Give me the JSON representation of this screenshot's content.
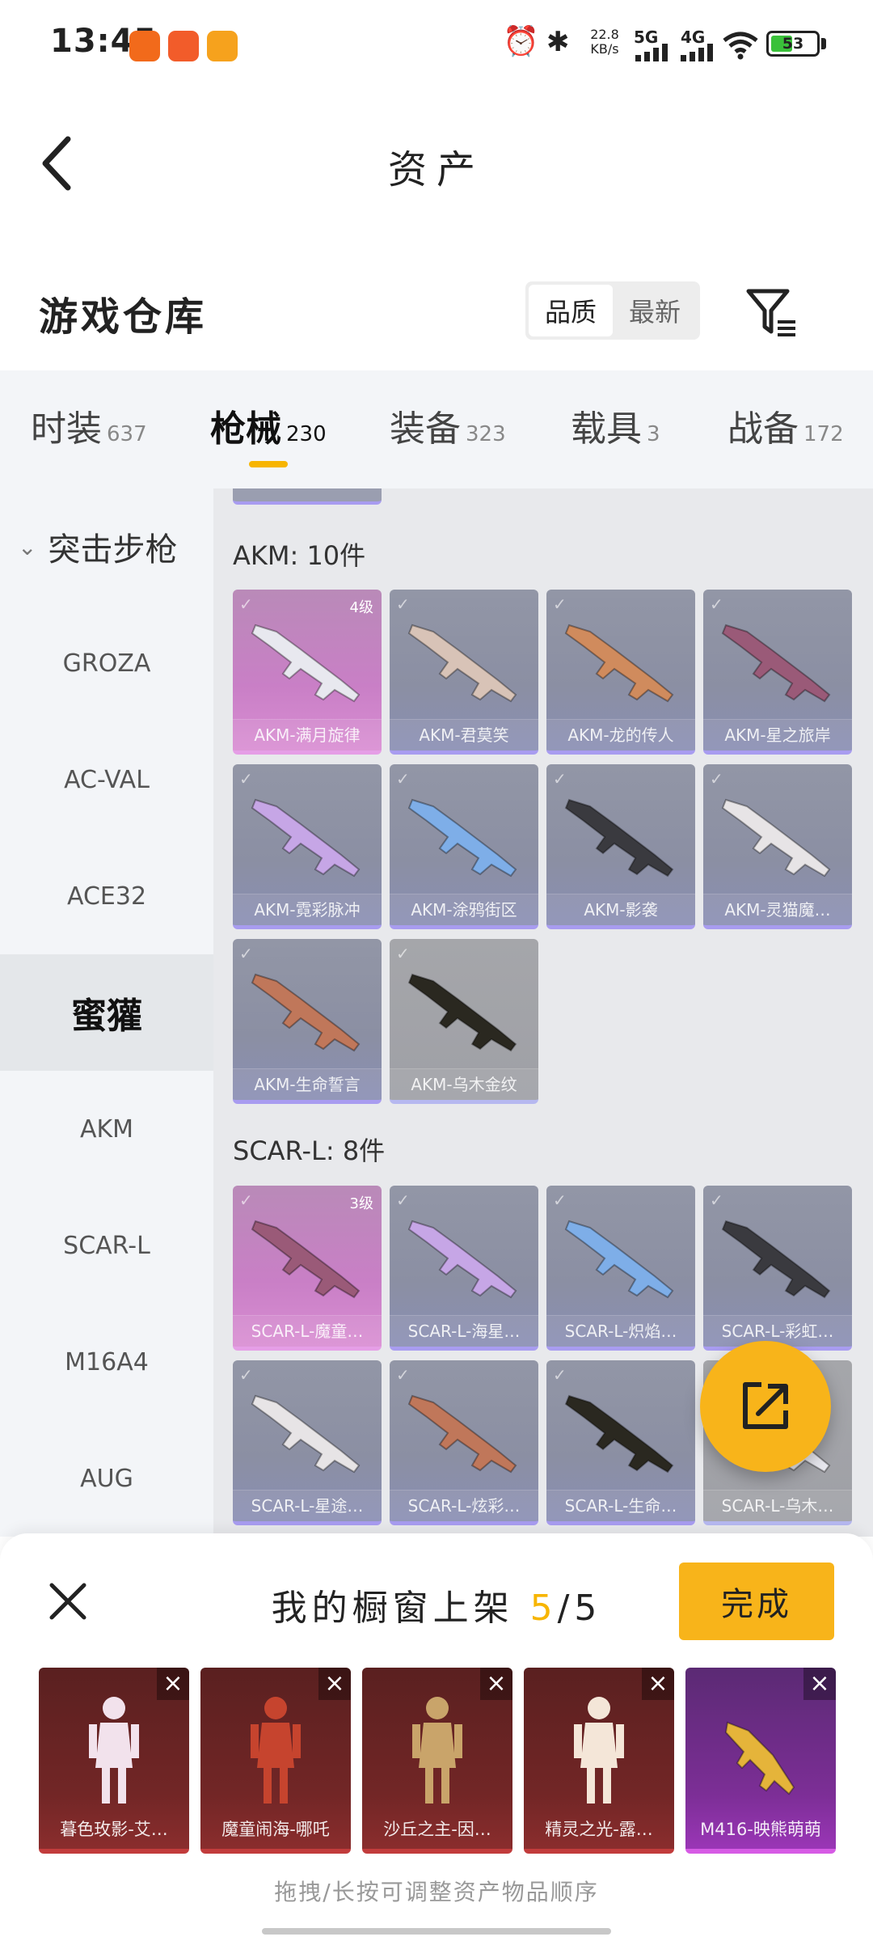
{
  "status": {
    "time": "13:45",
    "net_speed": "22.8",
    "net_unit": "KB/s",
    "net1": "5G",
    "net2": "4G",
    "battery": "53"
  },
  "header": {
    "title": "资产"
  },
  "warehouse": {
    "title": "游戏仓库",
    "sort_options": [
      "品质",
      "最新"
    ],
    "sort_active": "品质"
  },
  "tabs": [
    {
      "label": "时装",
      "count": "637"
    },
    {
      "label": "枪械",
      "count": "230"
    },
    {
      "label": "装备",
      "count": "323"
    },
    {
      "label": "载具",
      "count": "3"
    },
    {
      "label": "战备",
      "count": "172"
    }
  ],
  "sidebar": {
    "category": "突击步枪",
    "items": [
      "GROZA",
      "AC-VAL",
      "ACE32",
      "蜜獾",
      "AKM",
      "SCAR-L",
      "M16A4",
      "AUG"
    ],
    "active": "蜜獾"
  },
  "sections": [
    {
      "title": "AKM: 10件",
      "items": [
        {
          "name": "AKM-满月旋律",
          "level": "4级",
          "rarity": "pink"
        },
        {
          "name": "AKM-君莫笑",
          "level": "",
          "rarity": "purple"
        },
        {
          "name": "AKM-龙的传人",
          "level": "",
          "rarity": "purple"
        },
        {
          "name": "AKM-星之旅岸",
          "level": "",
          "rarity": "purple"
        },
        {
          "name": "AKM-霓彩脉冲",
          "level": "",
          "rarity": "purple"
        },
        {
          "name": "AKM-涂鸦街区",
          "level": "",
          "rarity": "purple"
        },
        {
          "name": "AKM-影袭",
          "level": "",
          "rarity": "purple"
        },
        {
          "name": "AKM-灵猫魔…",
          "level": "",
          "rarity": "purple"
        },
        {
          "name": "AKM-生命誓言",
          "level": "",
          "rarity": "purple"
        },
        {
          "name": "AKM-乌木金纹",
          "level": "",
          "rarity": "grey"
        }
      ]
    },
    {
      "title": "SCAR-L: 8件",
      "items": [
        {
          "name": "SCAR-L-魔童…",
          "level": "3级",
          "rarity": "pink"
        },
        {
          "name": "SCAR-L-海星…",
          "level": "",
          "rarity": "purple"
        },
        {
          "name": "SCAR-L-炽焰…",
          "level": "",
          "rarity": "purple"
        },
        {
          "name": "SCAR-L-彩虹…",
          "level": "",
          "rarity": "purple"
        },
        {
          "name": "SCAR-L-星途…",
          "level": "",
          "rarity": "purple"
        },
        {
          "name": "SCAR-L-炫彩…",
          "level": "",
          "rarity": "purple"
        },
        {
          "name": "SCAR-L-生命…",
          "level": "",
          "rarity": "purple"
        },
        {
          "name": "SCAR-L-乌木…",
          "level": "",
          "rarity": "grey"
        }
      ]
    }
  ],
  "panel": {
    "title": "我的橱窗上架",
    "current": "5",
    "total": "/5",
    "done_label": "完成",
    "items": [
      {
        "name": "暮色玫影-艾…",
        "rarity": "red"
      },
      {
        "name": "魔童闹海-哪吒",
        "rarity": "red"
      },
      {
        "name": "沙丘之主-因…",
        "rarity": "red"
      },
      {
        "name": "精灵之光-露…",
        "rarity": "red"
      },
      {
        "name": "M416-映熊萌萌",
        "rarity": "purple"
      }
    ],
    "hint": "拖拽/长按可调整资产物品顺序"
  },
  "colors": {
    "accent": "#f8b41a",
    "underline": "#f7b500",
    "legendary": "#c97fc6",
    "epic": "#8b8fa3"
  }
}
